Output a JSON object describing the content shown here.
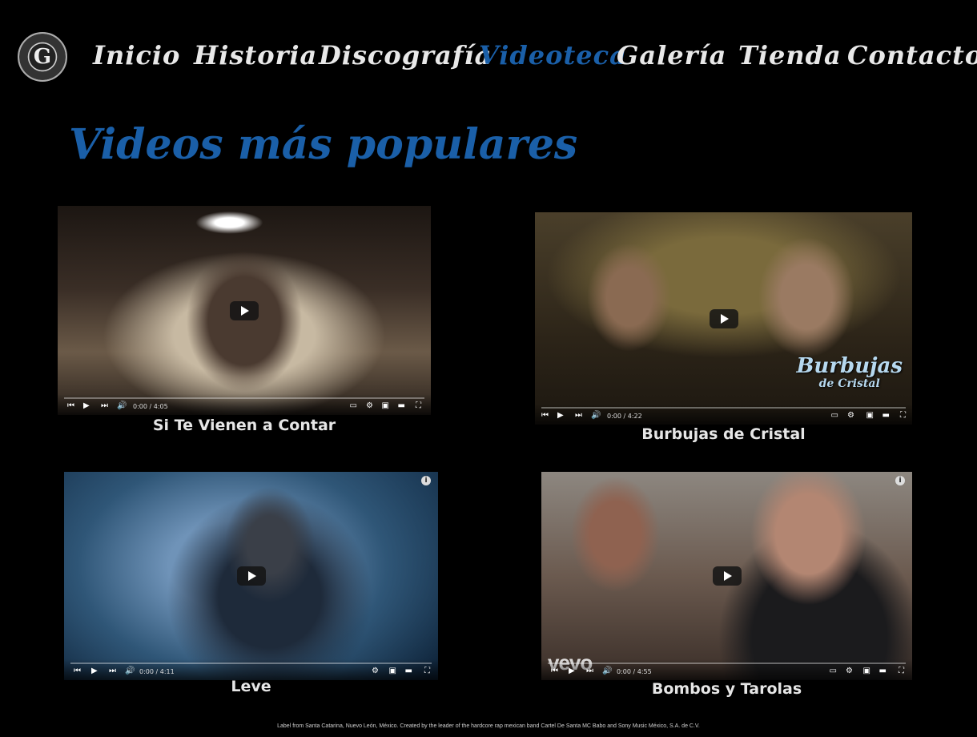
{
  "nav": {
    "items": [
      {
        "label": "Inicio",
        "active": false
      },
      {
        "label": "Historia",
        "active": false
      },
      {
        "label": "Discografía",
        "active": false
      },
      {
        "label": "Videoteca",
        "active": true
      },
      {
        "label": "Galería",
        "active": false
      },
      {
        "label": "Tienda",
        "active": false
      },
      {
        "label": "Contactos",
        "active": false
      }
    ],
    "active_color": "#1a5fa8"
  },
  "logo": {
    "letter": "G"
  },
  "section_title": "Videos más populares",
  "videos": [
    {
      "title": "Si Te Vienen a Contar",
      "time": "0:00 / 4:05"
    },
    {
      "title": "Burbujas de Cristal",
      "time": "0:00 / 4:22",
      "badge": "Burbujas",
      "badge_sub": "de Cristal"
    },
    {
      "title": "Leve",
      "time": "0:00 / 4:11"
    },
    {
      "title": "Bombos y Tarolas",
      "time": "0:00 / 4:55",
      "watermark": "vevo"
    }
  ],
  "footer": "Label from Santa Catarina, Nuevo León, México. Created by the leader of the hardcore rap mexican band Cartel De Santa MC Babo and Sony Music México, S.A. de C.V."
}
